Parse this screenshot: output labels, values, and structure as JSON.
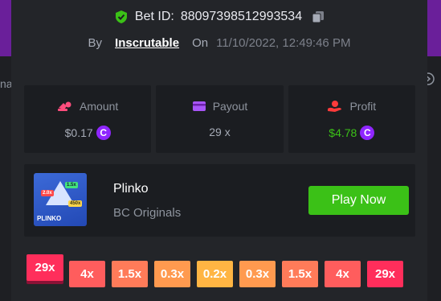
{
  "edge_left_text": "na",
  "bet": {
    "label": "Bet ID:",
    "id": "88097398512993534"
  },
  "by": {
    "by_label": "By",
    "user": "Inscrutable",
    "on_label": "On",
    "datetime": "11/10/2022, 12:49:46 PM"
  },
  "stats": {
    "amount": {
      "label": "Amount",
      "value": "$0.17",
      "coin": "C"
    },
    "payout": {
      "label": "Payout",
      "value": "29 x"
    },
    "profit": {
      "label": "Profit",
      "value": "$4.78",
      "coin": "C"
    }
  },
  "game": {
    "title": "Plinko",
    "provider": "BC Originals",
    "thumb": {
      "name": "PLINKO",
      "tag1": "2.0x",
      "tag2": "1.5x",
      "tag3": "450x"
    },
    "play_label": "Play Now"
  },
  "multipliers": [
    {
      "label": "29x",
      "color": "#ff2e5b",
      "selected": true
    },
    {
      "label": "4x",
      "color": "#ff5d5d",
      "selected": false
    },
    {
      "label": "1.5x",
      "color": "#ff7b59",
      "selected": false
    },
    {
      "label": "0.3x",
      "color": "#ff9a4f",
      "selected": false
    },
    {
      "label": "0.2x",
      "color": "#ffb543",
      "selected": false
    },
    {
      "label": "0.3x",
      "color": "#ff9a4f",
      "selected": false
    },
    {
      "label": "1.5x",
      "color": "#ff7b59",
      "selected": false
    },
    {
      "label": "4x",
      "color": "#ff5d5d",
      "selected": false
    },
    {
      "label": "29x",
      "color": "#ff2e5b",
      "selected": false
    }
  ],
  "colors": {
    "accent_green": "#3bc117",
    "coin_purple": "#8f26ff",
    "panel": "#232529"
  }
}
